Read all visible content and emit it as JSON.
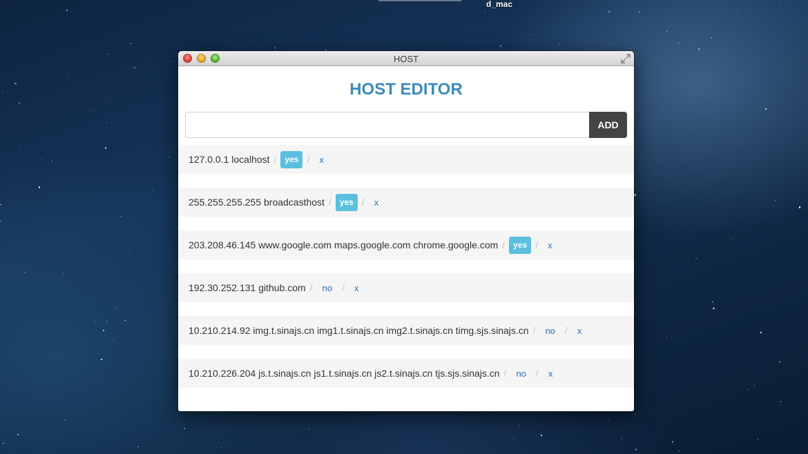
{
  "desktop": {
    "label": "d_mac"
  },
  "window": {
    "title": "HOST"
  },
  "app": {
    "title": "HOST EDITOR"
  },
  "add_form": {
    "input_value": "",
    "button_label": "ADD"
  },
  "separator": "/",
  "hosts": [
    {
      "entry": "127.0.0.1 localhost",
      "status": "yes",
      "remove": "x"
    },
    {
      "entry": "255.255.255.255 broadcasthost",
      "status": "yes",
      "remove": "x"
    },
    {
      "entry": "203.208.46.145 www.google.com maps.google.com chrome.google.com",
      "status": "yes",
      "remove": "x"
    },
    {
      "entry": "192.30.252.131 github.com",
      "status": "no",
      "remove": "x"
    },
    {
      "entry": "10.210.214.92 img.t.sinajs.cn img1.t.sinajs.cn img2.t.sinajs.cn timg.sjs.sinajs.cn",
      "status": "no",
      "remove": "x"
    },
    {
      "entry": "10.210.226.204 js.t.sinajs.cn js1.t.sinajs.cn js2.t.sinajs.cn tjs.sjs.sinajs.cn",
      "status": "no",
      "remove": "x"
    }
  ],
  "colors": {
    "accent": "#3b8bba",
    "badge": "#5bc0de",
    "link": "#2a6fb0",
    "add_button": "#444444"
  }
}
